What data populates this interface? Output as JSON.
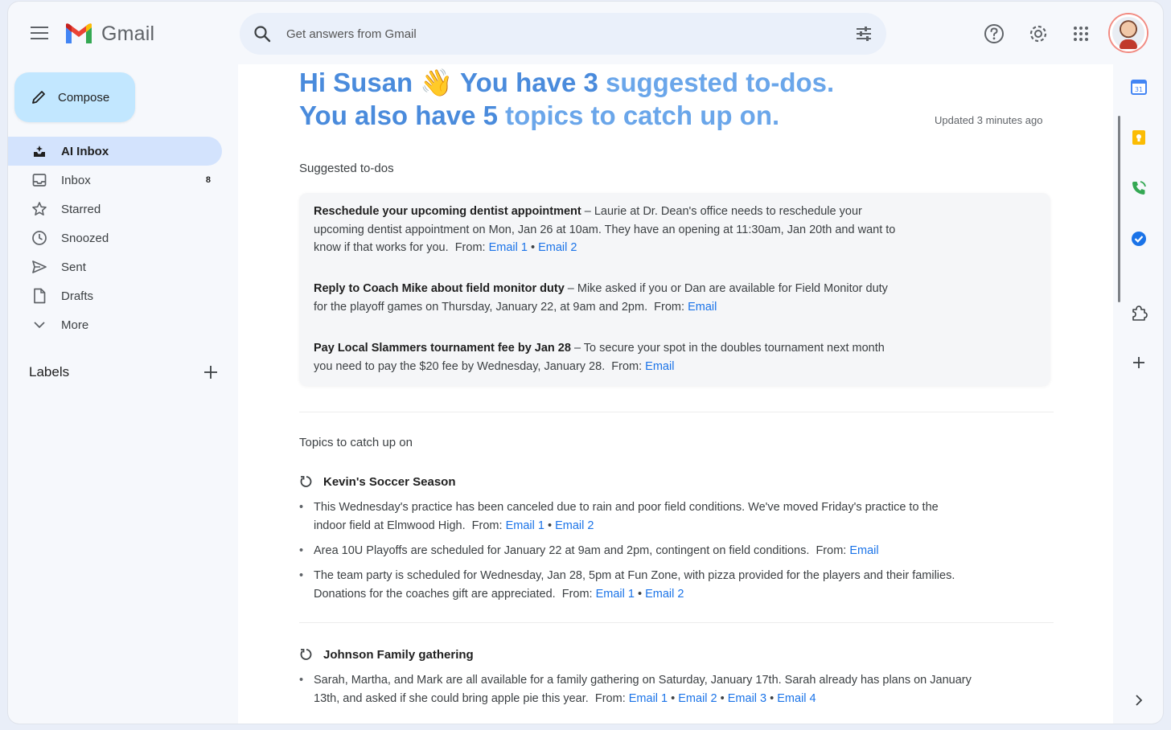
{
  "header": {
    "app_name": "Gmail",
    "search_placeholder": "Get answers from Gmail"
  },
  "sidebar": {
    "compose_label": "Compose",
    "items": [
      {
        "label": "AI Inbox",
        "icon": "ai-inbox-icon",
        "active": true,
        "count": ""
      },
      {
        "label": "Inbox",
        "icon": "inbox-icon",
        "active": false,
        "count": "8"
      },
      {
        "label": "Starred",
        "icon": "star-icon",
        "active": false,
        "count": ""
      },
      {
        "label": "Snoozed",
        "icon": "clock-icon",
        "active": false,
        "count": ""
      },
      {
        "label": "Sent",
        "icon": "send-icon",
        "active": false,
        "count": ""
      },
      {
        "label": "Drafts",
        "icon": "draft-icon",
        "active": false,
        "count": ""
      },
      {
        "label": "More",
        "icon": "chevron-down-icon",
        "active": false,
        "count": ""
      }
    ],
    "labels_title": "Labels"
  },
  "main": {
    "greeting": {
      "line1_a": "Hi Susan",
      "emoji": "👋",
      "line1_b": "You have 3",
      "line1_c": "suggested to-dos.",
      "line2_a": "You also have 5",
      "line2_b": "topics to catch up on."
    },
    "updated": "Updated 3 minutes ago",
    "todos_title": "Suggested to-dos",
    "todos": [
      {
        "title": "Reschedule your upcoming dentist appointment",
        "text_1": " – Laurie at Dr. Dean's office needs to reschedule your",
        "text_2": "upcoming dentist appointment on Mon, Jan 26 at 10am. They have an opening at 11:30am, Jan 20th and want to",
        "text_3": "know if that works for you.",
        "from": "From:",
        "link_1": "Email 1",
        "sep": "•",
        "link_2": "Email 2"
      },
      {
        "title": "Reply to Coach Mike about field monitor duty",
        "text_1": " – Mike asked if you or Dan are available for Field Monitor duty",
        "text_2": "for the playoff games on Thursday, January 22, at 9am and 2pm.",
        "from": "From:",
        "link_1": "Email"
      },
      {
        "title": "Pay Local Slammers tournament fee by Jan 28",
        "text_1": " – To secure your spot in the doubles tournament next month",
        "text_2": "you need to pay the $20 fee by Wednesday, January 28.",
        "from": "From:",
        "link_1": "Email"
      }
    ],
    "topics_title": "Topics to catch up on",
    "topics": [
      {
        "title": "Kevin's Soccer Season",
        "bullets": [
          {
            "line_1": "This Wednesday's practice has been canceled due to rain and poor field conditions. We've moved Friday's practice to the",
            "line_2": "indoor field at Elmwood High.",
            "from": "From:",
            "links": [
              "Email 1",
              "Email 2"
            ]
          },
          {
            "line_1": "Area 10U Playoffs are scheduled for January 22 at 9am and 2pm, contingent on field conditions.",
            "from": "From:",
            "links": [
              "Email"
            ]
          },
          {
            "line_1": "The team party is scheduled for Wednesday, Jan 28, 5pm at Fun Zone, with pizza provided for the players and their families.",
            "line_2": "Donations for the coaches gift are appreciated.",
            "from": "From:",
            "links": [
              "Email 1",
              "Email 2"
            ]
          }
        ]
      },
      {
        "title": "Johnson Family gathering",
        "bullets": [
          {
            "line_1": "Sarah, Martha, and Mark are all available for a family gathering on Saturday, January 17th. Sarah already has plans on January",
            "line_2": "13th, and asked if she could bring apple pie this year.",
            "from": "From:",
            "links": [
              "Email 1",
              "Email 2",
              "Email 3",
              "Email 4"
            ]
          }
        ]
      }
    ]
  },
  "right_panel": {
    "icons": [
      "calendar-icon",
      "keep-icon",
      "phone-icon",
      "tasks-icon",
      "puzzle-icon",
      "add-icon",
      "chevron-right-icon"
    ]
  },
  "colors": {
    "accent_blue": "#1a73e8",
    "greeting_blue": "#4a8bdc",
    "compose_bg": "#c2e7ff",
    "active_nav_bg": "#d3e3fd"
  }
}
